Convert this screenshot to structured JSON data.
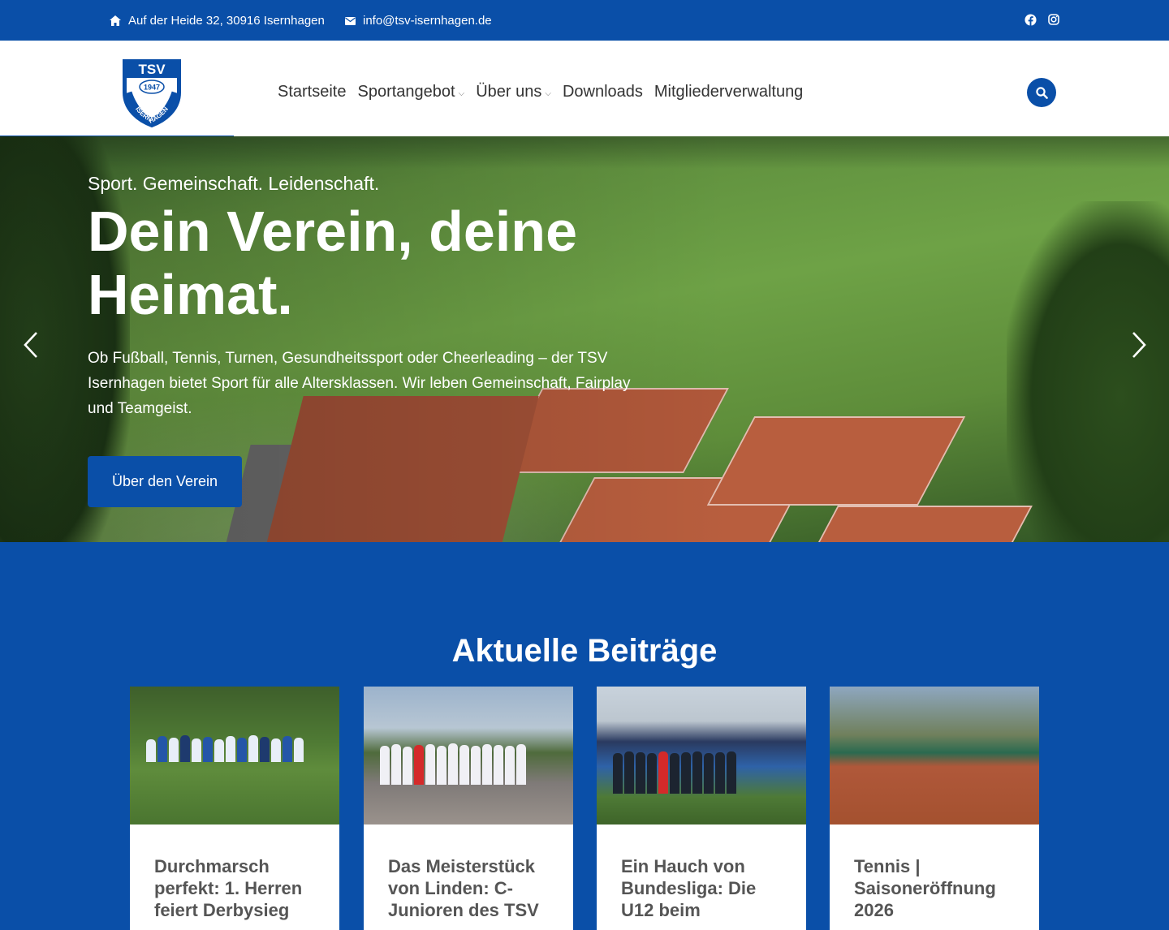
{
  "topbar": {
    "address": "Auf der Heide 32, 30916 Isernhagen",
    "email": "info@tsv-isernhagen.de",
    "social": [
      "facebook-icon",
      "instagram-icon"
    ]
  },
  "logo": {
    "line1": "TSV",
    "year": "1947",
    "line2": "ISERNHAGEN"
  },
  "nav": {
    "items": [
      {
        "label": "Startseite",
        "has_dropdown": false
      },
      {
        "label": "Sportangebot",
        "has_dropdown": true
      },
      {
        "label": "Über uns",
        "has_dropdown": true
      },
      {
        "label": "Downloads",
        "has_dropdown": false
      },
      {
        "label": "Mitgliederverwaltung",
        "has_dropdown": false
      }
    ]
  },
  "hero": {
    "tagline": "Sport. Gemeinschaft. Leidenschaft.",
    "headline": "Dein Verein, deine Heimat.",
    "description": "Ob Fußball, Tennis, Turnen, Gesundheitssport oder Cheerleading – der TSV Isernhagen bietet Sport für alle Altersklassen. Wir leben Gemeinschaft, Fairplay und Teamgeist.",
    "cta_label": "Über den Verein"
  },
  "posts": {
    "heading": "Aktuelle Beiträge",
    "cards": [
      {
        "title": "Durchmarsch perfekt: 1. Herren feiert Derbysieg"
      },
      {
        "title": "Das Meisterstück von Linden: C-Junioren des TSV"
      },
      {
        "title": "Ein Hauch von Bundesliga: Die U12 beim"
      },
      {
        "title": "Tennis | Saisoneröffnung 2026"
      }
    ]
  },
  "colors": {
    "brand": "#0a4fa8",
    "white": "#ffffff",
    "text": "#333333"
  }
}
